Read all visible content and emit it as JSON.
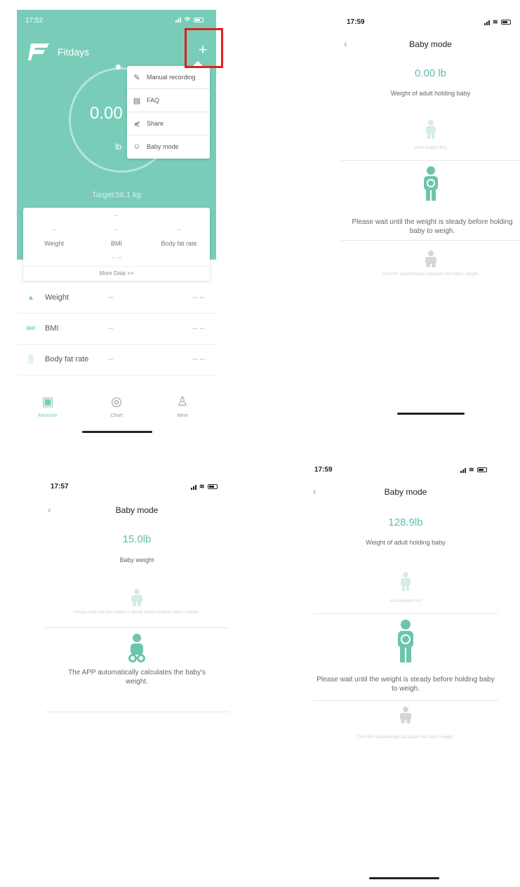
{
  "screen1": {
    "status_time": "17:52",
    "app_name": "Fitdays",
    "plus_label": "+",
    "weight_value": "0.00",
    "weight_unit": "lb",
    "target": "Target:56.1 kg",
    "menu": [
      {
        "icon": "edit-icon",
        "label": "Manual recording"
      },
      {
        "icon": "book-icon",
        "label": "FAQ"
      },
      {
        "icon": "share-icon",
        "label": "Share"
      },
      {
        "icon": "baby-icon",
        "label": "Baby mode"
      }
    ],
    "card": {
      "top_dash": "--",
      "cols": [
        {
          "value": "--",
          "label": "Weight"
        },
        {
          "value": "--",
          "label": "BMI"
        },
        {
          "value": "--",
          "label": "Body fat rate"
        }
      ],
      "mid_dash": "-- --",
      "more": "More Data >>"
    },
    "rows": [
      {
        "icon": "weight-scale-icon",
        "label": "Weight",
        "value": "--",
        "right": "-- --"
      },
      {
        "icon": "bmi-icon",
        "icon_text": "BMI",
        "label": "BMI",
        "value": "--",
        "right": "-- --"
      },
      {
        "icon": "body-fat-icon",
        "label": "Body fat rate",
        "value": "--",
        "right": "-- --"
      }
    ],
    "tabs": [
      {
        "icon": "scale-icon",
        "label": "Measure"
      },
      {
        "icon": "chart-icon",
        "label": "Chart"
      },
      {
        "icon": "person-icon",
        "label": "Mine"
      }
    ]
  },
  "screen2": {
    "status_time": "17:59",
    "title": "Baby mode",
    "weight_value": "0.00 lb",
    "subtitle": "Weight of adult holding baby",
    "step1": "Adult weighs first",
    "step2": "Please wait until the weight is steady before holding baby to weigh.",
    "step3": "The APP automatically calculates the baby's weight."
  },
  "screen3": {
    "status_time": "17:57",
    "title": "Baby mode",
    "weight_value": "15.0lb",
    "subtitle": "Baby weight",
    "step1": "Please wait until the weight is steady before holding baby to weigh.",
    "step2": "The APP automatically calculates the baby's weight."
  },
  "screen4": {
    "status_time": "17:59",
    "title": "Baby mode",
    "weight_value": "128.9lb",
    "subtitle": "Weight of adult holding baby",
    "step1": "Adult weighs first",
    "step2": "Please wait until the weight is steady before holding baby to weigh.",
    "step3": "The APP automatically calculates the baby's weight."
  },
  "colors": {
    "accent": "#79cdb8",
    "teal_text": "#5bbfb0",
    "highlight": "#e0201c"
  }
}
